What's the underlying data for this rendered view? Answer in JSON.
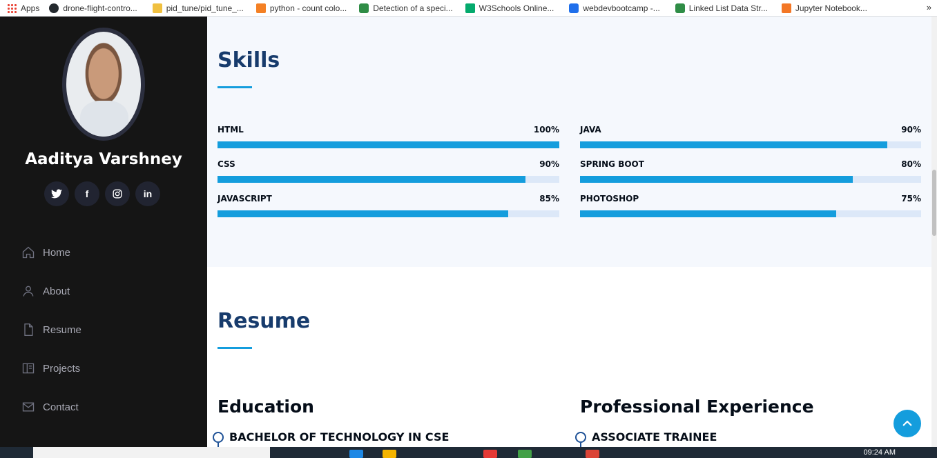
{
  "bookmarks": [
    {
      "label": "Apps",
      "icon": "apps-grid-icon"
    },
    {
      "label": "drone-flight-contro...",
      "icon": "github-icon"
    },
    {
      "label": "pid_tune/pid_tune_...",
      "icon": "page-icon"
    },
    {
      "label": "python - count colo...",
      "icon": "stackoverflow-icon"
    },
    {
      "label": "Detection of a speci...",
      "icon": "geeksforgeeks-icon"
    },
    {
      "label": "W3Schools Online...",
      "icon": "w3schools-icon"
    },
    {
      "label": "webdevbootcamp -...",
      "icon": "webdev-icon"
    },
    {
      "label": "Linked List Data Str...",
      "icon": "geeksforgeeks-icon"
    },
    {
      "label": "Jupyter Notebook...",
      "icon": "jupyter-icon"
    }
  ],
  "bookmarks_more": "»",
  "sidebar": {
    "name": "Aaditya Varshney",
    "socials": [
      {
        "name": "twitter-icon",
        "glyph": "🐦"
      },
      {
        "name": "facebook-icon",
        "glyph": "f"
      },
      {
        "name": "instagram-icon",
        "glyph": "◎"
      },
      {
        "name": "linkedin-icon",
        "glyph": "in"
      }
    ],
    "nav": [
      {
        "label": "Home",
        "icon": "home-icon"
      },
      {
        "label": "About",
        "icon": "person-icon"
      },
      {
        "label": "Resume",
        "icon": "file-icon"
      },
      {
        "label": "Projects",
        "icon": "book-icon"
      },
      {
        "label": "Contact",
        "icon": "envelope-icon"
      }
    ]
  },
  "skills": {
    "title": "Skills",
    "items": [
      {
        "name": "HTML",
        "percent_label": "100%",
        "value": 100
      },
      {
        "name": "JAVA",
        "percent_label": "90%",
        "value": 90
      },
      {
        "name": "CSS",
        "percent_label": "90%",
        "value": 90
      },
      {
        "name": "SPRING BOOT",
        "percent_label": "80%",
        "value": 80
      },
      {
        "name": "JAVASCRIPT",
        "percent_label": "85%",
        "value": 85
      },
      {
        "name": "PHOTOSHOP",
        "percent_label": "75%",
        "value": 75
      }
    ]
  },
  "resume": {
    "title": "Resume",
    "education": {
      "heading": "Education",
      "first_item": "BACHELOR OF TECHNOLOGY IN CSE"
    },
    "experience": {
      "heading": "Professional Experience",
      "first_item": "ASSOCIATE TRAINEE"
    }
  },
  "taskbar": {
    "time": "09:24 AM"
  },
  "colors": {
    "accent": "#149ddd",
    "heading": "#173b6c",
    "sidebar_bg": "#151515",
    "skills_bg": "#f5f8fd"
  }
}
